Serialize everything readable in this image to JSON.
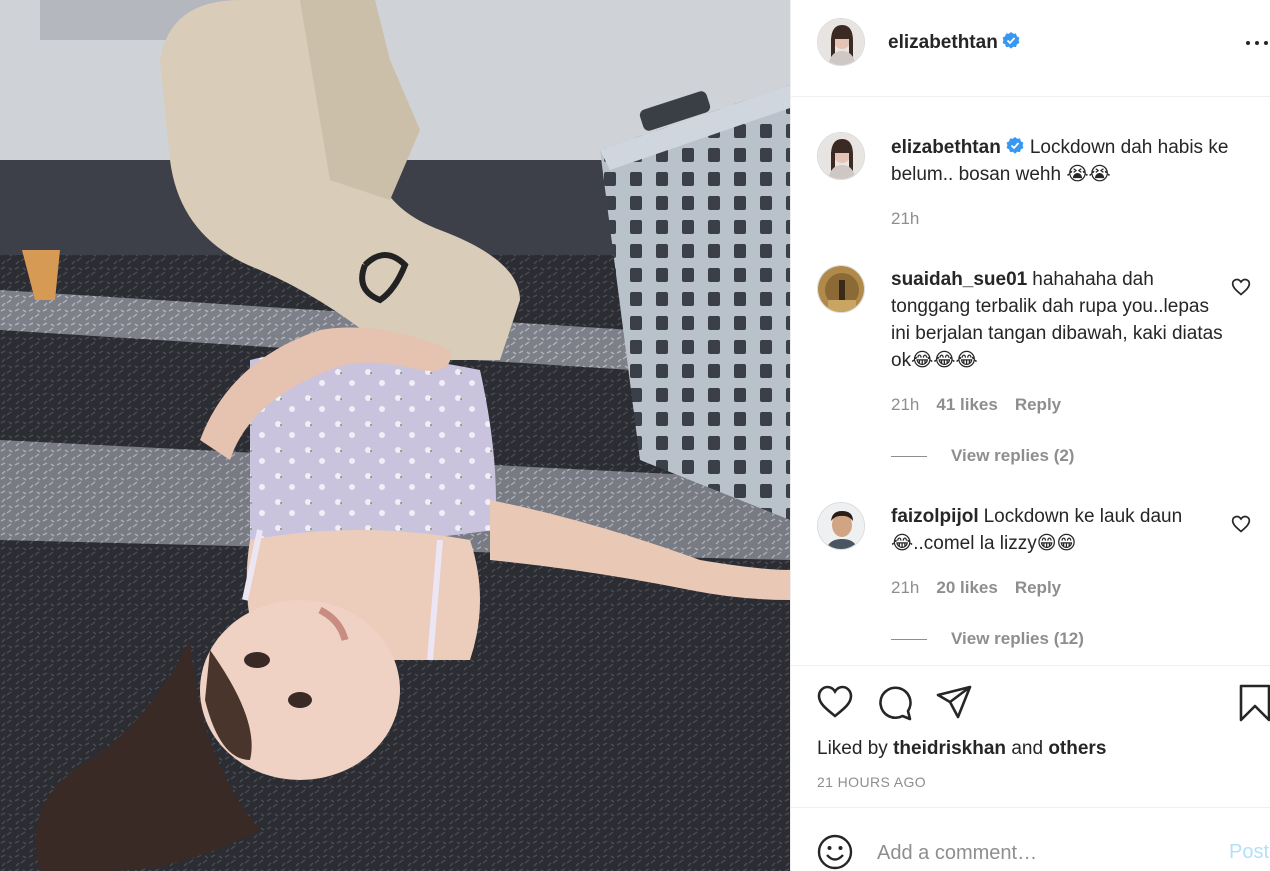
{
  "header": {
    "username": "elizabethtan",
    "verified_icon": "verified-badge-icon",
    "more_icon": "more-options-icon"
  },
  "caption": {
    "username": "elizabethtan",
    "text": "Lockdown dah habis ke belum.. bosan wehh 😭😭",
    "time": "21h"
  },
  "comments": [
    {
      "username": "suaidah_sue01",
      "text": "hahahaha dah tonggang terbalik dah rupa you..lepas ini berjalan tangan dibawah, kaki diatas ok😂😂😂",
      "time": "21h",
      "likes": "41 likes",
      "reply_label": "Reply",
      "view_replies": "View replies (2)"
    },
    {
      "username": "faizolpijol",
      "text": "Lockdown ke lauk daun 😂..comel la lizzy😁😁",
      "time": "21h",
      "likes": "20 likes",
      "reply_label": "Reply",
      "view_replies": "View replies (12)"
    }
  ],
  "actions": {
    "liked_by_prefix": "Liked by",
    "liked_by_user": "theidriskhan",
    "liked_by_and": "and",
    "liked_by_others": "others",
    "time_ago": "21 HOURS AGO"
  },
  "add_comment": {
    "placeholder": "Add a comment…",
    "post_label": "Post"
  },
  "colors": {
    "link_disabled": "#b2dffc",
    "verified": "#3897f0",
    "muted": "#8e8e8e",
    "text": "#262626"
  }
}
